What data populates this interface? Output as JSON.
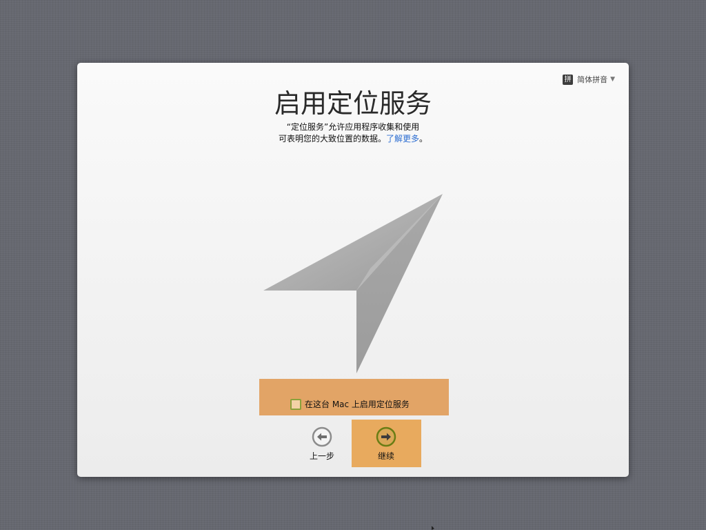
{
  "input_menu": {
    "badge": "拼",
    "label": "简体拼音",
    "caret": "▼"
  },
  "title": "启用定位服务",
  "description": {
    "line1": "“定位服务”允许应用程序收集和使用",
    "line2": "可表明您的大致位置的数据。",
    "link": "了解更多",
    "end": "。"
  },
  "icons": {
    "arrow": "location-arrow-icon",
    "back": "back-arrow-circle-icon",
    "continue": "forward-arrow-circle-icon"
  },
  "checkbox": {
    "label": "在这台 Mac 上启用定位服务",
    "checked": false
  },
  "buttons": {
    "back": "上一步",
    "continue": "继续"
  },
  "colors": {
    "link": "#2d6ed2",
    "highlight": "#e2a466",
    "checkbox_border": "#8aa13a"
  }
}
